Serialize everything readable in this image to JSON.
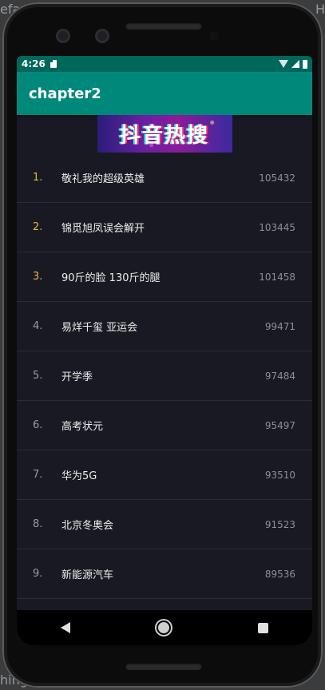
{
  "host": {
    "edge_left_top": "efa",
    "edge_left_bottom": "hing",
    "edge_right_top": "H"
  },
  "status_bar": {
    "time": "4:26",
    "icons": [
      "sd-card-icon",
      "wifi-icon",
      "signal-icon",
      "battery-icon"
    ]
  },
  "app_bar": {
    "title": "chapter2"
  },
  "banner": {
    "text": "抖音热搜"
  },
  "hot_list": [
    {
      "rank": "1.",
      "title": "敬礼我的超级英雄",
      "hot": "105432",
      "highlight": true
    },
    {
      "rank": "2.",
      "title": "锦觅旭凤误会解开",
      "hot": "103445",
      "highlight": true
    },
    {
      "rank": "3.",
      "title": "90斤的脸 130斤的腿",
      "hot": "101458",
      "highlight": true
    },
    {
      "rank": "4.",
      "title": "易烊千玺 亚运会",
      "hot": "99471",
      "highlight": false
    },
    {
      "rank": "5.",
      "title": "开学季",
      "hot": "97484",
      "highlight": false
    },
    {
      "rank": "6.",
      "title": "高考状元",
      "hot": "95497",
      "highlight": false
    },
    {
      "rank": "7.",
      "title": "华为5G",
      "hot": "93510",
      "highlight": false
    },
    {
      "rank": "8.",
      "title": "北京冬奥会",
      "hot": "91523",
      "highlight": false
    },
    {
      "rank": "9.",
      "title": "新能源汽车",
      "hot": "89536",
      "highlight": false
    }
  ],
  "colors": {
    "status_bar": "#00675b",
    "app_bar": "#00897b",
    "list_bg": "#181922",
    "top_rank": "#e8b73a",
    "rank": "#9a9ba3"
  },
  "nav_bar": {
    "icons": [
      "back-icon",
      "home-icon",
      "recent-apps-icon"
    ]
  }
}
